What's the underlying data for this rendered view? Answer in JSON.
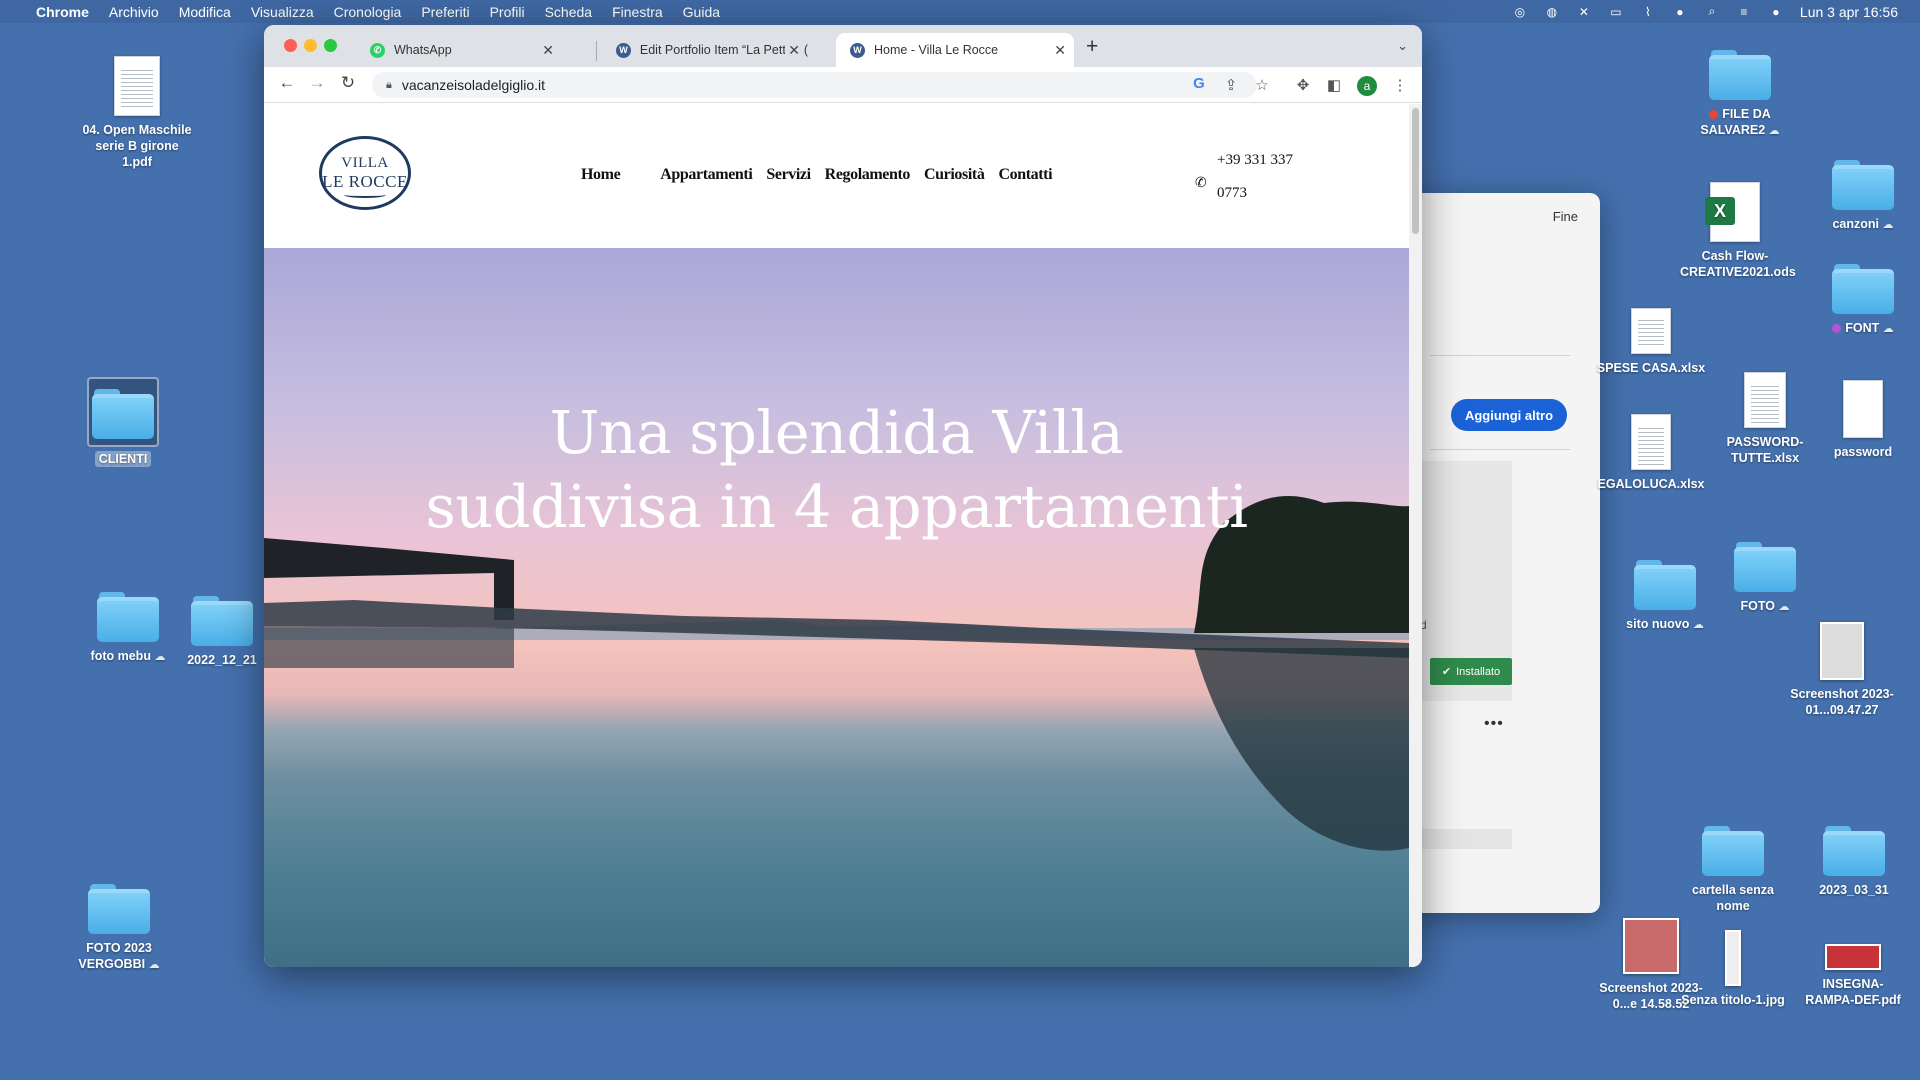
{
  "menubar": {
    "app": "Chrome",
    "items": [
      "Archivio",
      "Modifica",
      "Visualizza",
      "Cronologia",
      "Preferiti",
      "Profili",
      "Scheda",
      "Finestra",
      "Guida"
    ],
    "datetime": "Lun 3 apr  16:56"
  },
  "desktop": {
    "left_items": [
      {
        "label": "04. Open Maschile serie B girone 1.pdf",
        "type": "pdf"
      },
      {
        "label": "CLIENTI",
        "type": "folder"
      },
      {
        "label": "foto mebu",
        "type": "folder"
      },
      {
        "label": "2022_12_21",
        "type": "folder"
      },
      {
        "label": "FOTO 2023 VERGOBBI",
        "type": "folder"
      }
    ],
    "right_items": [
      {
        "label": "FILE DA SALVARE2",
        "type": "folder",
        "tag_color": "#e8443a"
      },
      {
        "label": "canzoni",
        "type": "folder"
      },
      {
        "label": "Cash Flow-CREATIVE2021.ods",
        "type": "xls"
      },
      {
        "label": "FONT",
        "type": "folder",
        "tag_color": "#b455d6"
      },
      {
        "label": "SPESE CASA.xlsx",
        "type": "doc"
      },
      {
        "label": "PASSWORD-TUTTE.xlsx",
        "type": "doc"
      },
      {
        "label": "password",
        "type": "doc"
      },
      {
        "label": "EGALOLUCA.xlsx",
        "type": "doc"
      },
      {
        "label": "sito nuovo",
        "type": "folder"
      },
      {
        "label": "FOTO",
        "type": "folder"
      },
      {
        "label": "Screenshot 2023-01...09.47.27",
        "type": "image"
      },
      {
        "label": "cartella senza nome",
        "type": "folder"
      },
      {
        "label": "2023_03_31",
        "type": "folder"
      },
      {
        "label": "Screenshot 2023-0...e 14.58.52",
        "type": "image"
      },
      {
        "label": "Senza titolo-1.jpg",
        "type": "image"
      },
      {
        "label": "INSEGNA-RAMPA-DEF.pdf",
        "type": "pdf"
      }
    ]
  },
  "bg_window": {
    "done": "Fine",
    "add_button": "Aggiungi altro",
    "installed": "Installato",
    "fragment": "d",
    "more": "•••"
  },
  "browser": {
    "tabs": [
      {
        "title": "WhatsApp",
        "favicon": "#25d366"
      },
      {
        "title": "Edit Portfolio Item “La Petti” ‹ (",
        "favicon": "#3b5c8f"
      },
      {
        "title": "Home - Villa Le Rocce",
        "favicon": "#3b5c8f"
      }
    ],
    "url": "vacanzeisoladelgiglio.it",
    "avatar": "a"
  },
  "site": {
    "logo": {
      "line1": "VILLA",
      "line2": "LE ROCCE"
    },
    "nav": [
      "Home",
      "Appartamenti",
      "Servizi",
      "Regolamento",
      "Curiosità",
      "Contatti"
    ],
    "phone": "+39 331 337 0773",
    "hero_title_1": "Una splendida Villa",
    "hero_title_2": "suddivisa in 4 appartamenti"
  }
}
